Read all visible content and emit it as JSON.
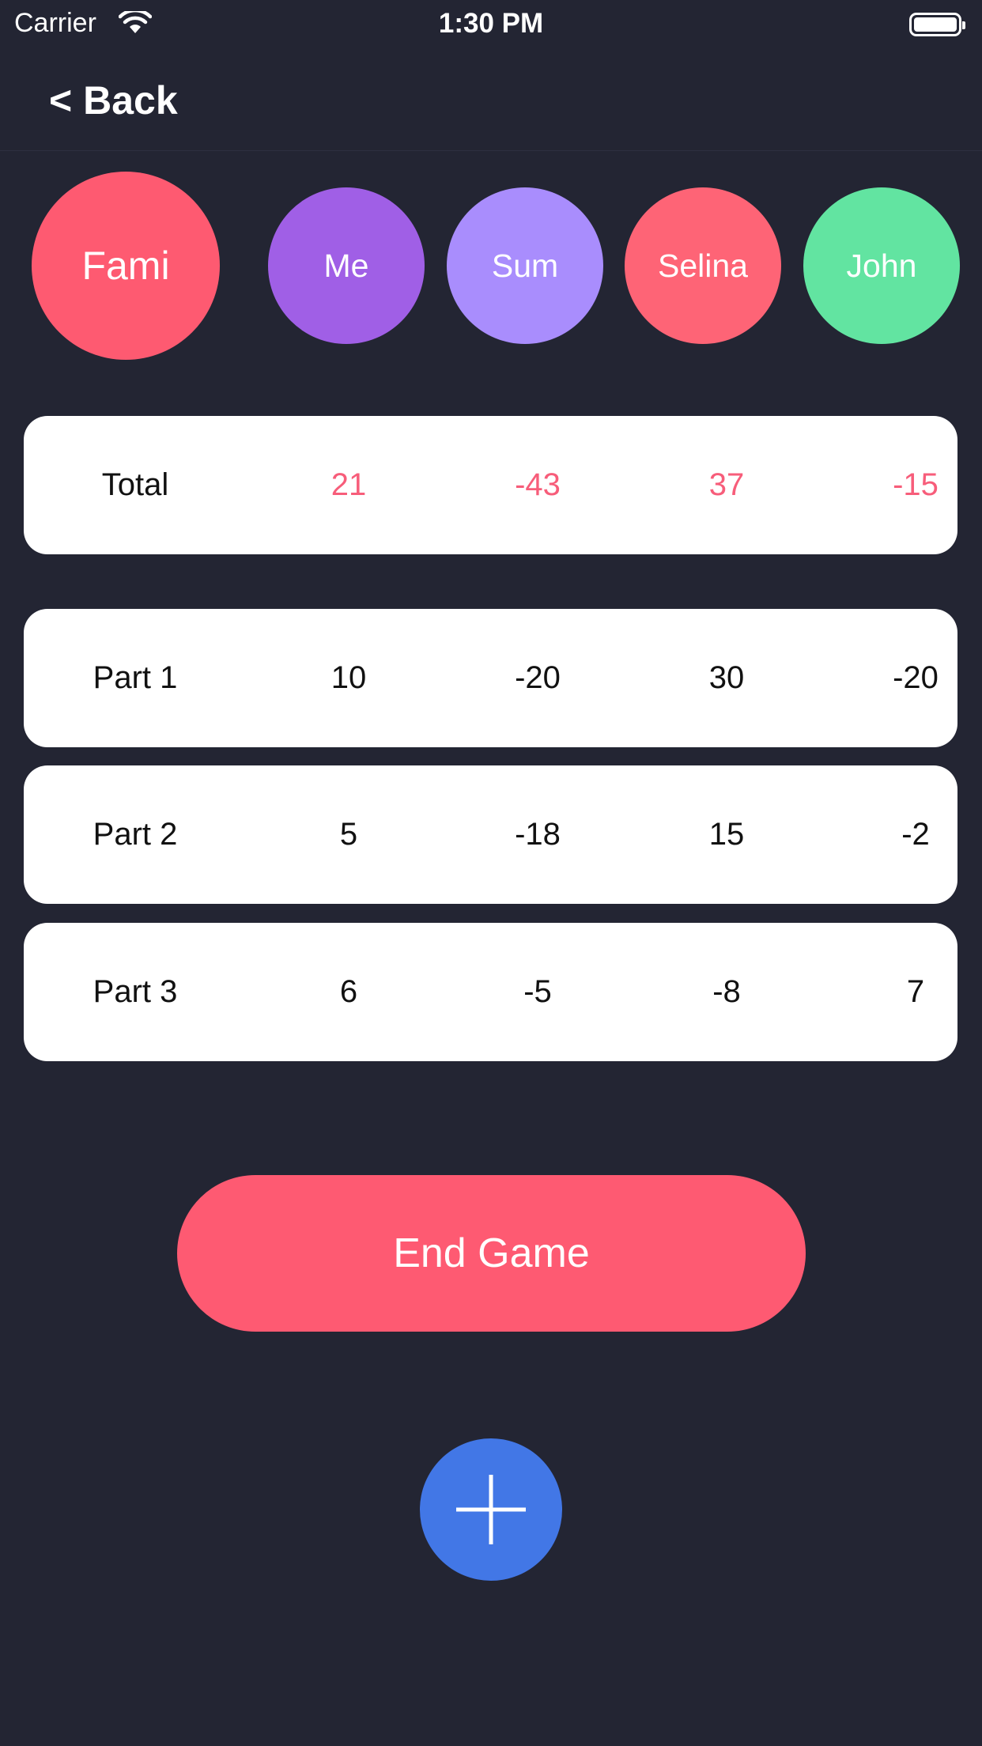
{
  "status_bar": {
    "carrier": "Carrier",
    "time": "1:30 PM",
    "wifi_icon": "wifi-icon",
    "battery_icon": "battery-icon"
  },
  "nav": {
    "back_label": "< Back"
  },
  "players": {
    "dealer": "Fami",
    "p1": "Me",
    "p2": "Sum",
    "p3": "Selina",
    "p4": "John"
  },
  "player_colors": {
    "Fami": "#fe5a71",
    "Me": "#a05fe6",
    "Sum": "#a98dfd",
    "Selina": "#fe6476",
    "John": "#62e4a1"
  },
  "scores": {
    "total": {
      "label": "Total",
      "values": [
        "21",
        "-43",
        "37",
        "-15"
      ]
    },
    "rounds": [
      {
        "label": "Part 1",
        "values": [
          "10",
          "-20",
          "30",
          "-20"
        ]
      },
      {
        "label": "Part 2",
        "values": [
          "5",
          "-18",
          "15",
          "-2"
        ]
      },
      {
        "label": "Part 3",
        "values": [
          "6",
          "-5",
          "-8",
          "7"
        ]
      }
    ]
  },
  "actions": {
    "end_game_label": "End Game",
    "add_icon": "plus-icon"
  },
  "colors": {
    "background": "#232533",
    "accent": "#fe5a72",
    "total_text": "#f75d7a",
    "add_button": "#4277e6"
  }
}
